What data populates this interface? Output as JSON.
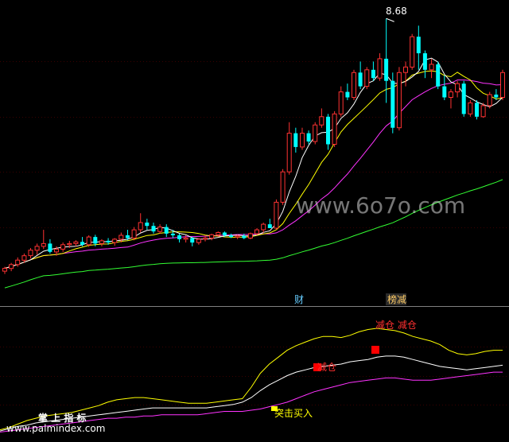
{
  "chart_data": [
    {
      "type": "candlestick",
      "panel": "main",
      "annotation_high": "8.68",
      "colors": {
        "up": "#ff3232",
        "down": "#00ffff",
        "ma_fast": "#ffffff",
        "ma_mid": "#ffff00",
        "ma_slow": "#ff33ff",
        "ma_long": "#33ff33"
      },
      "candles": [
        [
          4.1,
          4.18,
          4.05,
          4.15
        ],
        [
          4.15,
          4.25,
          4.1,
          4.22
        ],
        [
          4.22,
          4.35,
          4.18,
          4.3
        ],
        [
          4.3,
          4.42,
          4.25,
          4.38
        ],
        [
          4.38,
          4.52,
          4.33,
          4.48
        ],
        [
          4.48,
          4.6,
          4.4,
          4.55
        ],
        [
          4.55,
          4.85,
          4.5,
          4.6
        ],
        [
          4.6,
          4.68,
          4.42,
          4.45
        ],
        [
          4.45,
          4.55,
          4.38,
          4.5
        ],
        [
          4.5,
          4.62,
          4.45,
          4.58
        ],
        [
          4.58,
          4.65,
          4.52,
          4.6
        ],
        [
          4.6,
          4.66,
          4.55,
          4.63
        ],
        [
          4.63,
          4.72,
          4.55,
          4.58
        ],
        [
          4.58,
          4.75,
          4.54,
          4.72
        ],
        [
          4.72,
          4.76,
          4.55,
          4.6
        ],
        [
          4.6,
          4.68,
          4.55,
          4.65
        ],
        [
          4.65,
          4.7,
          4.58,
          4.62
        ],
        [
          4.62,
          4.7,
          4.56,
          4.68
        ],
        [
          4.68,
          4.8,
          4.62,
          4.75
        ],
        [
          4.75,
          4.85,
          4.66,
          4.7
        ],
        [
          4.7,
          4.9,
          4.66,
          4.85
        ],
        [
          4.85,
          5.15,
          4.8,
          4.98
        ],
        [
          4.98,
          5.05,
          4.85,
          4.92
        ],
        [
          4.92,
          4.98,
          4.78,
          4.82
        ],
        [
          4.82,
          4.95,
          4.78,
          4.9
        ],
        [
          4.9,
          4.95,
          4.72,
          4.78
        ],
        [
          4.78,
          4.85,
          4.7,
          4.75
        ],
        [
          4.75,
          4.78,
          4.62,
          4.68
        ],
        [
          4.68,
          4.75,
          4.62,
          4.7
        ],
        [
          4.7,
          4.72,
          4.55,
          4.62
        ],
        [
          4.62,
          4.7,
          4.58,
          4.68
        ],
        [
          4.68,
          4.75,
          4.64,
          4.7
        ],
        [
          4.7,
          4.78,
          4.66,
          4.76
        ],
        [
          4.76,
          4.82,
          4.72,
          4.8
        ],
        [
          4.8,
          4.82,
          4.72,
          4.75
        ],
        [
          4.75,
          4.78,
          4.7,
          4.72
        ],
        [
          4.72,
          4.76,
          4.68,
          4.74
        ],
        [
          4.74,
          4.78,
          4.68,
          4.7
        ],
        [
          4.7,
          4.8,
          4.68,
          4.78
        ],
        [
          4.78,
          4.88,
          4.75,
          4.85
        ],
        [
          4.85,
          4.98,
          4.8,
          4.95
        ],
        [
          4.95,
          5.05,
          4.88,
          4.88
        ],
        [
          4.88,
          5.4,
          4.85,
          5.35
        ],
        [
          5.35,
          5.95,
          5.3,
          5.9
        ],
        [
          5.9,
          6.8,
          5.85,
          6.6
        ],
        [
          6.6,
          6.7,
          6.25,
          6.35
        ],
        [
          6.35,
          6.7,
          6.3,
          6.6
        ],
        [
          6.6,
          6.65,
          6.4,
          6.45
        ],
        [
          6.45,
          6.8,
          6.4,
          6.75
        ],
        [
          6.75,
          7.05,
          6.7,
          6.9
        ],
        [
          6.9,
          6.95,
          6.3,
          6.4
        ],
        [
          6.4,
          7.0,
          6.35,
          6.95
        ],
        [
          6.95,
          7.45,
          6.9,
          7.35
        ],
        [
          7.35,
          7.5,
          7.2,
          7.25
        ],
        [
          7.25,
          7.75,
          7.2,
          7.7
        ],
        [
          7.7,
          7.9,
          7.4,
          7.45
        ],
        [
          7.45,
          7.8,
          7.4,
          7.75
        ],
        [
          7.75,
          7.9,
          7.55,
          7.6
        ],
        [
          7.6,
          8.05,
          7.55,
          7.95
        ],
        [
          7.95,
          8.68,
          7.15,
          7.55
        ],
        [
          7.55,
          7.7,
          6.6,
          6.7
        ],
        [
          6.7,
          7.8,
          6.65,
          7.7
        ],
        [
          7.7,
          7.9,
          7.45,
          7.8
        ],
        [
          7.8,
          8.4,
          7.75,
          8.35
        ],
        [
          8.35,
          8.55,
          7.75,
          8.05
        ],
        [
          8.05,
          8.1,
          7.6,
          7.75
        ],
        [
          7.75,
          7.95,
          7.6,
          7.85
        ],
        [
          7.85,
          7.9,
          7.4,
          7.45
        ],
        [
          7.45,
          7.65,
          7.2,
          7.25
        ],
        [
          7.25,
          7.4,
          7.05,
          7.35
        ],
        [
          7.35,
          7.55,
          7.25,
          7.5
        ],
        [
          7.5,
          7.55,
          6.9,
          6.95
        ],
        [
          6.95,
          7.2,
          6.9,
          7.15
        ],
        [
          7.15,
          7.2,
          6.85,
          6.9
        ],
        [
          6.9,
          7.15,
          6.88,
          7.1
        ],
        [
          7.1,
          7.35,
          7.05,
          7.3
        ],
        [
          7.3,
          7.4,
          7.2,
          7.25
        ],
        [
          7.25,
          7.75,
          7.2,
          7.7
        ]
      ],
      "ylim": [
        3.9,
        8.9
      ]
    },
    {
      "type": "line",
      "panel": "indicator",
      "series": [
        {
          "color": "#ffff00",
          "values": [
            3,
            5,
            8,
            11,
            13,
            15,
            16,
            17,
            18,
            20,
            22,
            24,
            27,
            29,
            30,
            31,
            31,
            30,
            29,
            28,
            27,
            26,
            26,
            26,
            27,
            28,
            29,
            30,
            40,
            52,
            60,
            66,
            72,
            76,
            79,
            82,
            84,
            84,
            83,
            85,
            88,
            90,
            91,
            90,
            89,
            87,
            84,
            82,
            80,
            77,
            72,
            69,
            68,
            69,
            71,
            72,
            72
          ]
        },
        {
          "color": "#ffffff",
          "values": [
            2,
            4,
            6,
            7,
            9,
            10,
            11,
            12,
            13,
            14,
            15,
            16,
            17,
            18,
            19,
            20,
            21,
            22,
            22,
            22,
            22,
            22,
            22,
            22,
            23,
            24,
            25,
            27,
            31,
            37,
            42,
            46,
            50,
            53,
            55,
            57,
            58,
            59,
            60,
            62,
            63,
            64,
            66,
            67,
            67,
            66,
            64,
            62,
            60,
            58,
            57,
            56,
            55,
            56,
            57,
            58,
            59
          ]
        },
        {
          "color": "#ff33ff",
          "values": [
            1,
            2,
            3,
            4,
            5,
            6,
            7,
            8,
            9,
            10,
            11,
            12,
            13,
            13,
            14,
            14,
            15,
            15,
            16,
            16,
            16,
            16,
            16,
            17,
            18,
            19,
            19,
            19,
            20,
            21,
            23,
            25,
            27,
            30,
            33,
            36,
            38,
            40,
            42,
            44,
            45,
            46,
            47,
            48,
            48,
            47,
            46,
            46,
            46,
            47,
            48,
            49,
            50,
            51,
            52,
            53,
            53
          ]
        }
      ],
      "ylim": [
        0,
        100
      ]
    }
  ],
  "labels": {
    "high_mark": "8.68",
    "watermark": "www.6o7o.com",
    "tag_cai": "财",
    "tag_jianjian": "榜减",
    "signal_top": "减仓  减仓",
    "signal_mid": "减仓",
    "signal_buy": "突击买入",
    "brand": "掌 上 指 标",
    "url": "www.palmindex.com"
  }
}
